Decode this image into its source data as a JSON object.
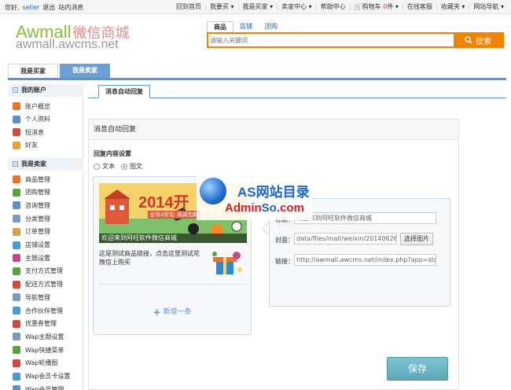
{
  "topbar": {
    "greeting": "您好,",
    "username": "seller",
    "logout": "退出",
    "messages": "站内消息",
    "items": [
      "回到首页",
      "我要买 ▾",
      "我是买家 ▾",
      "卖家中心 ▾",
      "帮助中心"
    ],
    "cart_label": "购物车",
    "cart_count": "0",
    "cart_unit": "件 ▾",
    "items2": [
      "在线客服",
      "收藏夹 ▾",
      "网站导航 ▾"
    ]
  },
  "header": {
    "logo_en": "Awmall",
    "logo_cn": "微信商城",
    "logo_sub": "awmall.awcms.net"
  },
  "search": {
    "tabs": [
      "商品",
      "店铺",
      "团购"
    ],
    "placeholder": "请输入关键词",
    "button": "搜索"
  },
  "role_tabs": {
    "buyer": "我是买家",
    "seller": "我是卖家"
  },
  "sidebar": {
    "account_title": "我的账户",
    "account_items": [
      {
        "label": "账户概览",
        "icon": "home-icon",
        "color": "#e8742b"
      },
      {
        "label": "个人资料",
        "icon": "profile-card-icon",
        "color": "#5b8fc7"
      },
      {
        "label": "短消息",
        "icon": "message-icon",
        "color": "#d14a3b"
      },
      {
        "label": "好友",
        "icon": "friends-icon",
        "color": "#e8a23b"
      }
    ],
    "seller_title": "我是卖家",
    "seller_items": [
      {
        "label": "商品管理",
        "icon": "goods-icon",
        "color": "#e8742b"
      },
      {
        "label": "团购管理",
        "icon": "group-buy-icon",
        "color": "#5aa23b"
      },
      {
        "label": "咨询管理",
        "icon": "consult-icon",
        "color": "#5b8fc7"
      },
      {
        "label": "分类管理",
        "icon": "category-icon",
        "color": "#7a9bc0"
      },
      {
        "label": "订单管理",
        "icon": "order-icon",
        "color": "#d9a441"
      },
      {
        "label": "店铺设置",
        "icon": "shop-icon",
        "color": "#4a9bd4"
      },
      {
        "label": "主题设置",
        "icon": "theme-icon",
        "color": "#c24a8c"
      },
      {
        "label": "支付方式管理",
        "icon": "payment-icon",
        "color": "#5aa23b"
      },
      {
        "label": "配送方式管理",
        "icon": "delivery-icon",
        "color": "#d14a3b"
      },
      {
        "label": "导航管理",
        "icon": "nav-icon",
        "color": "#7a9bc0"
      },
      {
        "label": "合作伙伴管理",
        "icon": "partner-icon",
        "color": "#4a9bd4"
      },
      {
        "label": "优惠券管理",
        "icon": "coupon-icon",
        "color": "#d14a3b"
      },
      {
        "label": "Wap主题设置",
        "icon": "wap-theme-icon",
        "color": "#7a9bc0"
      },
      {
        "label": "Wap快捷菜单",
        "icon": "wap-menu-icon",
        "color": "#5aa23b"
      },
      {
        "label": "Wap轮播图",
        "icon": "wap-slider-icon",
        "color": "#d14a3b"
      },
      {
        "label": "Wap会员卡设置",
        "icon": "wap-card-icon",
        "color": "#4a9bd4"
      },
      {
        "label": "Wap会员管理",
        "icon": "wap-member-icon",
        "color": "#5b8fc7"
      }
    ]
  },
  "content": {
    "tab": "消息自动回复",
    "panel_title": "消息自动回复",
    "reply_settings": "回复内容设置",
    "radio_text": "文本",
    "radio_image": "图文",
    "card_banner": "2014开",
    "card_banner_sub": "全场3折起 满减包邮",
    "card_caption": "欢迎来到阿旺软件微信商城",
    "card_desc": "这是测试商品链接，点击这里测试花微信上购买",
    "add_more": "新增一条",
    "title_label": "标题：",
    "title_value": "欢迎来到阿旺软件微信商城",
    "cover_label": "封面：",
    "cover_value": "data/files/mall/weixin/20140626(",
    "pick_image": "选择图片",
    "link_label": "链接：",
    "link_value": "http://awmall.awcms.net/index.php?app=stor",
    "save": "保存"
  },
  "watermark": {
    "title": "AS网站目录",
    "sub_red": "Admin",
    "sub_blue": "So",
    "sub_tail": ".com"
  }
}
